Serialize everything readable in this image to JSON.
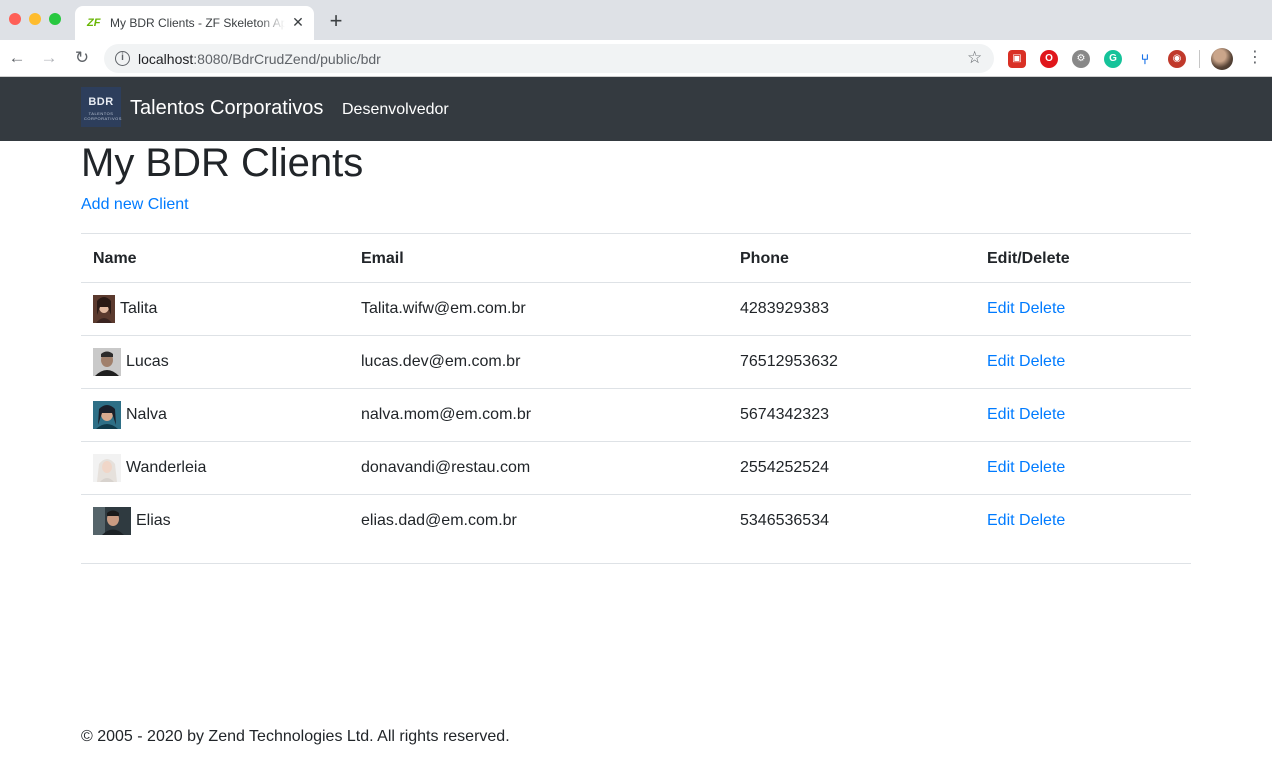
{
  "browser": {
    "tab_title": "My BDR Clients - ZF Skeleton Application",
    "tab_favicon": "ZF",
    "url_host": "localhost",
    "url_path": ":8080/BdrCrudZend/public/bdr"
  },
  "navbar": {
    "logo_text": "BDR",
    "logo_subtext": "TALENTOS CORPORATIVOS",
    "brand": "Talentos Corporativos",
    "link": "Desenvolvedor",
    "background": "#343a40"
  },
  "page": {
    "title": "My BDR Clients",
    "add_link": "Add new Client"
  },
  "table": {
    "headers": [
      "Name",
      "Email",
      "Phone",
      "Edit/Delete"
    ],
    "rows": [
      {
        "name": "Talita",
        "email": "Talita.wifw@em.com.br",
        "phone": "4283929383",
        "edit": "Edit",
        "delete": "Delete"
      },
      {
        "name": "Lucas",
        "email": "lucas.dev@em.com.br",
        "phone": "76512953632",
        "edit": "Edit",
        "delete": "Delete"
      },
      {
        "name": "Nalva",
        "email": "nalva.mom@em.com.br",
        "phone": "5674342323",
        "edit": "Edit",
        "delete": "Delete"
      },
      {
        "name": "Wanderleia",
        "email": "donavandi@restau.com",
        "phone": "2554252524",
        "edit": "Edit",
        "delete": "Delete"
      },
      {
        "name": "Elias",
        "email": "elias.dad@em.com.br",
        "phone": "5346536534",
        "edit": "Edit",
        "delete": "Delete"
      }
    ]
  },
  "footer": {
    "text": "© 2005 - 2020 by Zend Technologies Ltd. All rights reserved."
  },
  "colors": {
    "link": "#007bff",
    "text": "#212529",
    "border": "#dee2e6"
  }
}
